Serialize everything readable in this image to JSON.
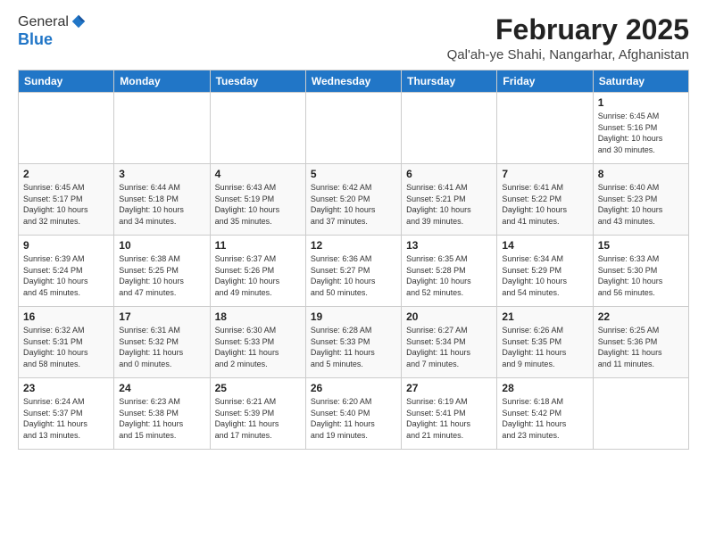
{
  "header": {
    "logo_general": "General",
    "logo_blue": "Blue",
    "month_title": "February 2025",
    "location": "Qal'ah-ye Shahi, Nangarhar, Afghanistan"
  },
  "days_of_week": [
    "Sunday",
    "Monday",
    "Tuesday",
    "Wednesday",
    "Thursday",
    "Friday",
    "Saturday"
  ],
  "weeks": [
    [
      {
        "day": "",
        "info": ""
      },
      {
        "day": "",
        "info": ""
      },
      {
        "day": "",
        "info": ""
      },
      {
        "day": "",
        "info": ""
      },
      {
        "day": "",
        "info": ""
      },
      {
        "day": "",
        "info": ""
      },
      {
        "day": "1",
        "info": "Sunrise: 6:45 AM\nSunset: 5:16 PM\nDaylight: 10 hours\nand 30 minutes."
      }
    ],
    [
      {
        "day": "2",
        "info": "Sunrise: 6:45 AM\nSunset: 5:17 PM\nDaylight: 10 hours\nand 32 minutes."
      },
      {
        "day": "3",
        "info": "Sunrise: 6:44 AM\nSunset: 5:18 PM\nDaylight: 10 hours\nand 34 minutes."
      },
      {
        "day": "4",
        "info": "Sunrise: 6:43 AM\nSunset: 5:19 PM\nDaylight: 10 hours\nand 35 minutes."
      },
      {
        "day": "5",
        "info": "Sunrise: 6:42 AM\nSunset: 5:20 PM\nDaylight: 10 hours\nand 37 minutes."
      },
      {
        "day": "6",
        "info": "Sunrise: 6:41 AM\nSunset: 5:21 PM\nDaylight: 10 hours\nand 39 minutes."
      },
      {
        "day": "7",
        "info": "Sunrise: 6:41 AM\nSunset: 5:22 PM\nDaylight: 10 hours\nand 41 minutes."
      },
      {
        "day": "8",
        "info": "Sunrise: 6:40 AM\nSunset: 5:23 PM\nDaylight: 10 hours\nand 43 minutes."
      }
    ],
    [
      {
        "day": "9",
        "info": "Sunrise: 6:39 AM\nSunset: 5:24 PM\nDaylight: 10 hours\nand 45 minutes."
      },
      {
        "day": "10",
        "info": "Sunrise: 6:38 AM\nSunset: 5:25 PM\nDaylight: 10 hours\nand 47 minutes."
      },
      {
        "day": "11",
        "info": "Sunrise: 6:37 AM\nSunset: 5:26 PM\nDaylight: 10 hours\nand 49 minutes."
      },
      {
        "day": "12",
        "info": "Sunrise: 6:36 AM\nSunset: 5:27 PM\nDaylight: 10 hours\nand 50 minutes."
      },
      {
        "day": "13",
        "info": "Sunrise: 6:35 AM\nSunset: 5:28 PM\nDaylight: 10 hours\nand 52 minutes."
      },
      {
        "day": "14",
        "info": "Sunrise: 6:34 AM\nSunset: 5:29 PM\nDaylight: 10 hours\nand 54 minutes."
      },
      {
        "day": "15",
        "info": "Sunrise: 6:33 AM\nSunset: 5:30 PM\nDaylight: 10 hours\nand 56 minutes."
      }
    ],
    [
      {
        "day": "16",
        "info": "Sunrise: 6:32 AM\nSunset: 5:31 PM\nDaylight: 10 hours\nand 58 minutes."
      },
      {
        "day": "17",
        "info": "Sunrise: 6:31 AM\nSunset: 5:32 PM\nDaylight: 11 hours\nand 0 minutes."
      },
      {
        "day": "18",
        "info": "Sunrise: 6:30 AM\nSunset: 5:33 PM\nDaylight: 11 hours\nand 2 minutes."
      },
      {
        "day": "19",
        "info": "Sunrise: 6:28 AM\nSunset: 5:33 PM\nDaylight: 11 hours\nand 5 minutes."
      },
      {
        "day": "20",
        "info": "Sunrise: 6:27 AM\nSunset: 5:34 PM\nDaylight: 11 hours\nand 7 minutes."
      },
      {
        "day": "21",
        "info": "Sunrise: 6:26 AM\nSunset: 5:35 PM\nDaylight: 11 hours\nand 9 minutes."
      },
      {
        "day": "22",
        "info": "Sunrise: 6:25 AM\nSunset: 5:36 PM\nDaylight: 11 hours\nand 11 minutes."
      }
    ],
    [
      {
        "day": "23",
        "info": "Sunrise: 6:24 AM\nSunset: 5:37 PM\nDaylight: 11 hours\nand 13 minutes."
      },
      {
        "day": "24",
        "info": "Sunrise: 6:23 AM\nSunset: 5:38 PM\nDaylight: 11 hours\nand 15 minutes."
      },
      {
        "day": "25",
        "info": "Sunrise: 6:21 AM\nSunset: 5:39 PM\nDaylight: 11 hours\nand 17 minutes."
      },
      {
        "day": "26",
        "info": "Sunrise: 6:20 AM\nSunset: 5:40 PM\nDaylight: 11 hours\nand 19 minutes."
      },
      {
        "day": "27",
        "info": "Sunrise: 6:19 AM\nSunset: 5:41 PM\nDaylight: 11 hours\nand 21 minutes."
      },
      {
        "day": "28",
        "info": "Sunrise: 6:18 AM\nSunset: 5:42 PM\nDaylight: 11 hours\nand 23 minutes."
      },
      {
        "day": "",
        "info": ""
      }
    ]
  ]
}
